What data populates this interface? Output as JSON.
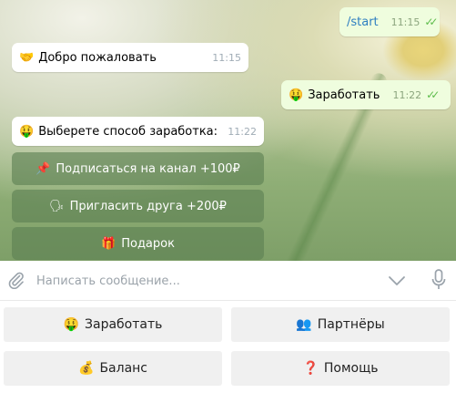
{
  "messages": [
    {
      "id": "start",
      "side": "out",
      "text": "/start",
      "time": "11:15",
      "read": true
    },
    {
      "id": "welcome",
      "side": "in",
      "emoji": "🤝",
      "text": "Добро пожаловать",
      "time": "11:15"
    },
    {
      "id": "earn",
      "side": "out",
      "emoji": "🤑",
      "text": "Заработать",
      "time": "11:22",
      "read": true
    },
    {
      "id": "choose",
      "side": "in",
      "emoji": "🤑",
      "text": "Выберете способ заработка:",
      "time": "11:22"
    }
  ],
  "inline_keyboard": [
    {
      "emoji": "📌",
      "label": "Подписаться на канал +100₽"
    },
    {
      "emoji": "🗣",
      "label": "Пригласить друга +200₽"
    },
    {
      "emoji": "🎁",
      "label": "Подарок"
    }
  ],
  "compose": {
    "placeholder": "Написать сообщение..."
  },
  "reply_keyboard": [
    {
      "emoji": "🤑",
      "label": "Заработать"
    },
    {
      "emoji": "👥",
      "label": "Партнёры"
    },
    {
      "emoji": "💰",
      "label": "Баланс"
    },
    {
      "emoji": "❓",
      "label": "Помощь"
    }
  ],
  "colors": {
    "tick": "#5fbd4d",
    "outgoing_bubble": "#effdde",
    "incoming_bubble": "#ffffff",
    "inline_button": "#5c8052"
  }
}
